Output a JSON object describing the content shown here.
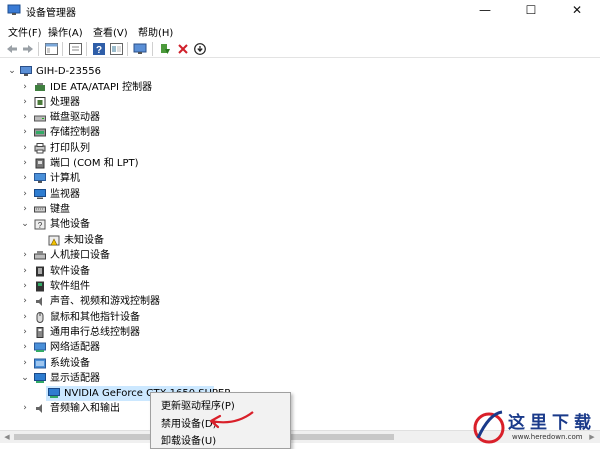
{
  "window": {
    "title": "设备管理器",
    "min_glyph": "—",
    "max_glyph": "☐",
    "close_glyph": "✕"
  },
  "menu": [
    {
      "label": "文件(F)"
    },
    {
      "label": "操作(A)"
    },
    {
      "label": "查看(V)"
    },
    {
      "label": "帮助(H)"
    }
  ],
  "tree": {
    "root": "GIH-D-23556",
    "items": [
      {
        "label": "IDE ATA/ATAPI 控制器",
        "icon": "ide-controller-icon",
        "expanded": false
      },
      {
        "label": "处理器",
        "icon": "processor-icon",
        "expanded": false
      },
      {
        "label": "磁盘驱动器",
        "icon": "disk-drive-icon",
        "expanded": false
      },
      {
        "label": "存储控制器",
        "icon": "storage-controller-icon",
        "expanded": false
      },
      {
        "label": "打印队列",
        "icon": "printer-icon",
        "expanded": false
      },
      {
        "label": "端口 (COM 和 LPT)",
        "icon": "port-icon",
        "expanded": false
      },
      {
        "label": "计算机",
        "icon": "computer-icon",
        "expanded": false
      },
      {
        "label": "监视器",
        "icon": "monitor-icon",
        "expanded": false
      },
      {
        "label": "键盘",
        "icon": "keyboard-icon",
        "expanded": false
      },
      {
        "label": "其他设备",
        "icon": "other-devices-icon",
        "expanded": true,
        "children": [
          "未知设备"
        ]
      },
      {
        "label": "人机接口设备",
        "icon": "hid-icon",
        "expanded": false
      },
      {
        "label": "软件设备",
        "icon": "software-device-icon",
        "expanded": false
      },
      {
        "label": "软件组件",
        "icon": "software-component-icon",
        "expanded": false
      },
      {
        "label": "声音、视频和游戏控制器",
        "icon": "sound-icon",
        "expanded": false
      },
      {
        "label": "鼠标和其他指针设备",
        "icon": "mouse-icon",
        "expanded": false
      },
      {
        "label": "通用串行总线控制器",
        "icon": "usb-icon",
        "expanded": false
      },
      {
        "label": "网络适配器",
        "icon": "network-icon",
        "expanded": false
      },
      {
        "label": "系统设备",
        "icon": "system-device-icon",
        "expanded": false
      },
      {
        "label": "显示适配器",
        "icon": "display-adapter-icon",
        "expanded": true,
        "children": [
          "NVIDIA GeForce GTX 1650 SUPER"
        ]
      },
      {
        "label": "音频输入和输出",
        "icon": "audio-io-icon",
        "expanded": false
      }
    ]
  },
  "context_menu": {
    "items": [
      {
        "label": "更新驱动程序(P)"
      },
      {
        "label": "禁用设备(D)"
      },
      {
        "label": "卸载设备(U)"
      }
    ]
  },
  "watermark": {
    "text": "这里下载",
    "url": "www.heredown.com"
  },
  "colors": {
    "selection": "#cce8ff",
    "annotation": "#d9202a",
    "watermark": "#1a3a8a"
  }
}
